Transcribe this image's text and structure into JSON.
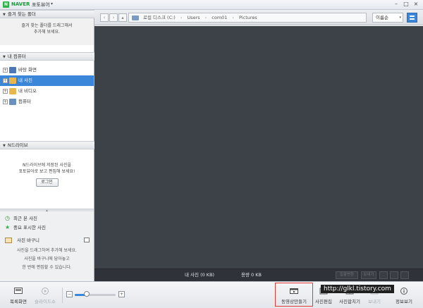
{
  "titlebar": {
    "logo_letter": "N",
    "brand": "NAVER",
    "app_name": "포토뷰어",
    "menu_arrow": "▾",
    "minimize": "–",
    "maximize": "□",
    "close": "×"
  },
  "sidebar": {
    "favorites": {
      "header": "즐겨 찾는 폴더",
      "hint_line1": "즐겨 찾는 폴더를 드래그해서",
      "hint_line2": "추가해 보세요."
    },
    "my_computer": {
      "header": "내 컴퓨터",
      "items": [
        {
          "label": "바탕 화면",
          "color": "#4a78b8"
        },
        {
          "label": "내 사진",
          "color": "#e8b64a"
        },
        {
          "label": "내 비디오",
          "color": "#e8b64a"
        },
        {
          "label": "컴퓨터",
          "color": "#6c8fc2"
        }
      ]
    },
    "ndrive": {
      "header": "N드라이브",
      "hint_line1": "N드라이브에 저장된 사진을",
      "hint_line2": "포토뷰어로 보고 편집해 보세요!",
      "login_label": "로그인"
    },
    "splitter_arrow": "▲",
    "quick": {
      "recent": "최근 본 사진",
      "important": "중요 표시한 사진"
    },
    "basket": {
      "title": "사진 바구니",
      "hint_line1": "사진을 드래그하여 추가해 보세요.",
      "hint_line2": "사진을 바구니에 담아놓고",
      "hint_line3": "한 번에 편집할 수 있습니다."
    }
  },
  "navbar": {
    "back": "‹",
    "forward": "›",
    "up": "▴",
    "path": [
      "로컬 디스크 (C:)",
      "Users",
      "com01",
      "Pictures"
    ],
    "sep": "›",
    "sort_label": "이름순",
    "sort_arrow": "▾"
  },
  "status": {
    "count": "내 사진 (0 KB)",
    "size": "용량 0 KB",
    "btn_rename": "일괄변환",
    "btn_share": "보내기"
  },
  "toolbar": {
    "catalog": "목록화면",
    "slideshow": "슬라이드쇼",
    "zoom_out": "−",
    "zoom_in": "+",
    "zoom_level": 0.3,
    "make_video": "동영상만들기",
    "photo_edit": "사진편집",
    "photo_merge": "사진합치기",
    "print": "보내기",
    "view_info": "정보보기"
  },
  "watermark": "http://glkl.tistory.com"
}
